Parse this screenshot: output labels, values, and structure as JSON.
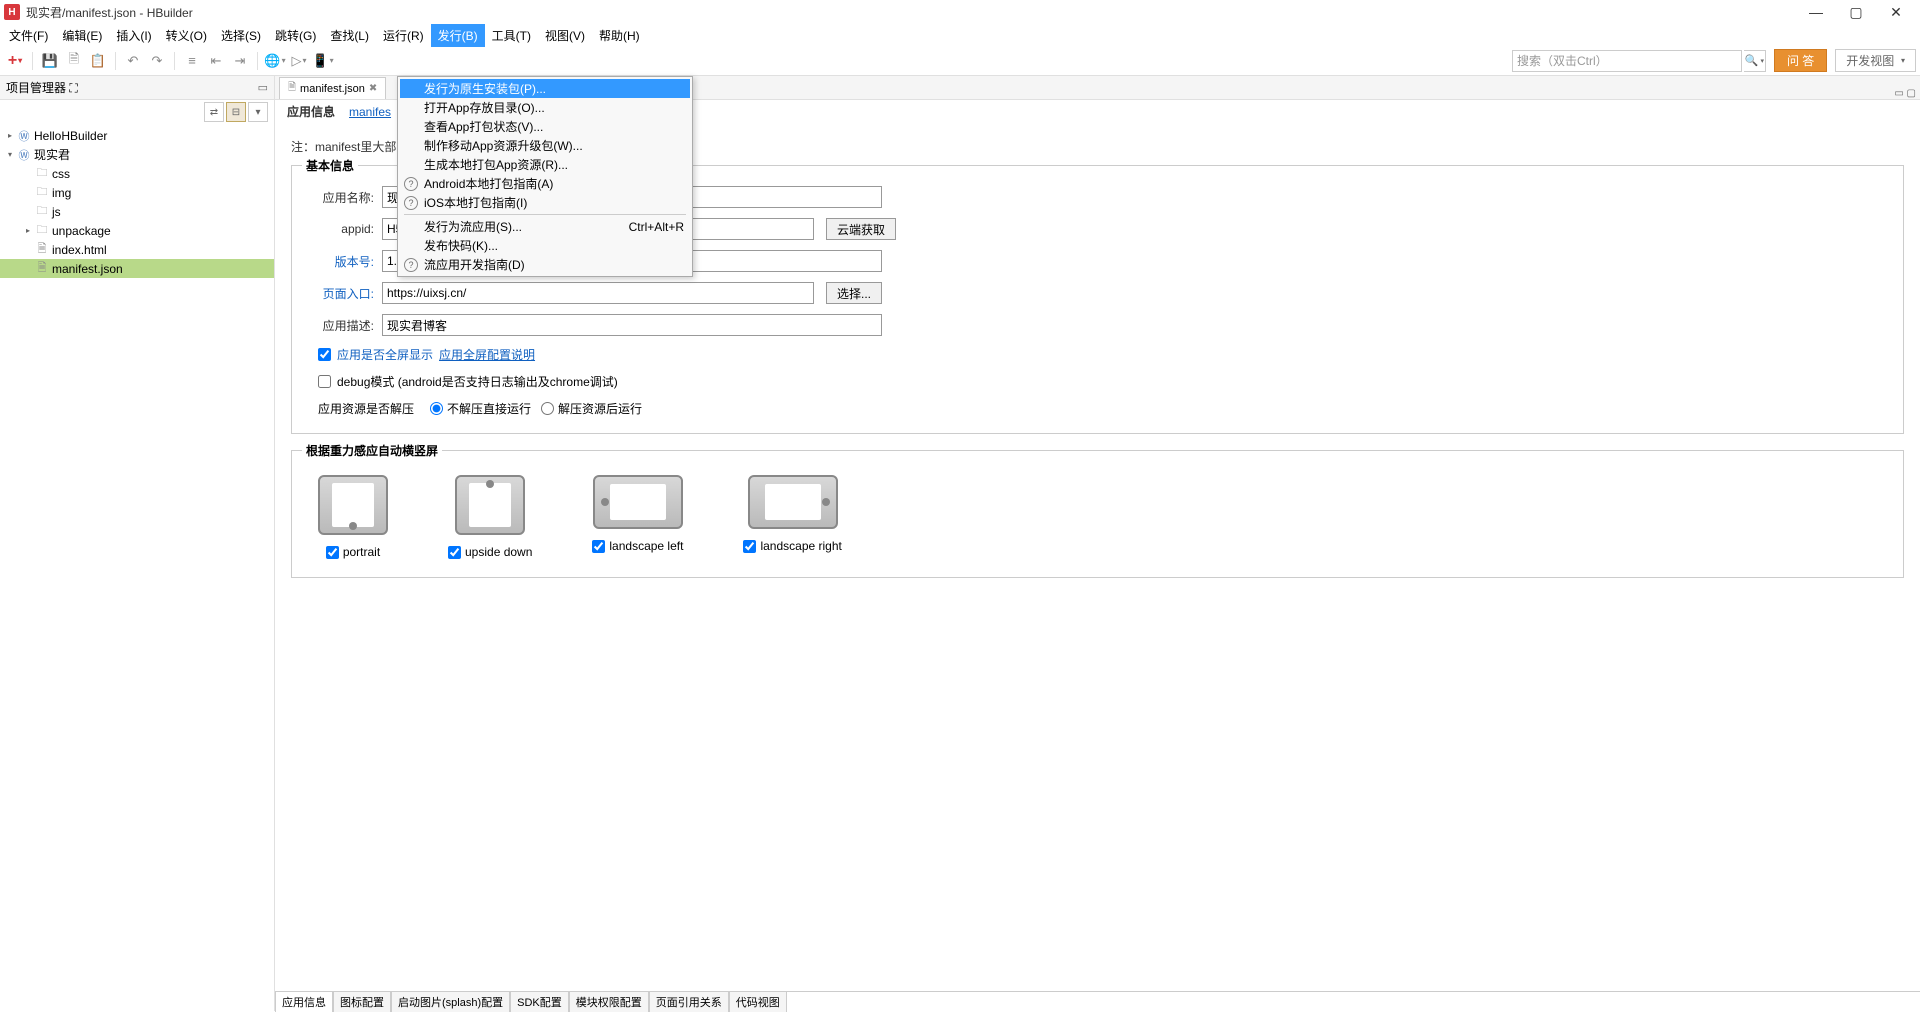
{
  "title": "现实君/manifest.json  -  HBuilder",
  "logo": "H",
  "menu": [
    "文件(F)",
    "编辑(E)",
    "插入(I)",
    "转义(O)",
    "选择(S)",
    "跳转(G)",
    "查找(L)",
    "运行(R)",
    "发行(B)",
    "工具(T)",
    "视图(V)",
    "帮助(H)"
  ],
  "toolbar": {
    "search_placeholder": "搜索（双击Ctrl）",
    "qa": "问 答",
    "view": "开发视图"
  },
  "sidebar": {
    "title": "项目管理器 ⛶",
    "tree": [
      {
        "expand": "▸",
        "icon": "web",
        "label": "HelloHBuilder",
        "indent": 0
      },
      {
        "expand": "▾",
        "icon": "web",
        "label": "现实君",
        "indent": 0
      },
      {
        "expand": "",
        "icon": "folder",
        "label": "css",
        "indent": 1
      },
      {
        "expand": "",
        "icon": "folder",
        "label": "img",
        "indent": 1
      },
      {
        "expand": "",
        "icon": "folder",
        "label": "js",
        "indent": 1
      },
      {
        "expand": "▸",
        "icon": "folder",
        "label": "unpackage",
        "indent": 1
      },
      {
        "expand": "",
        "icon": "file",
        "label": "index.html",
        "indent": 1
      },
      {
        "expand": "",
        "icon": "file",
        "label": "manifest.json",
        "indent": 1,
        "selected": true
      }
    ]
  },
  "dropdown": {
    "items": [
      {
        "label": "发行为原生安装包(P)...",
        "selected": true
      },
      {
        "label": "打开App存放目录(O)..."
      },
      {
        "label": "查看App打包状态(V)..."
      },
      {
        "label": "制作移动App资源升级包(W)..."
      },
      {
        "label": "生成本地打包App资源(R)..."
      },
      {
        "label": "Android本地打包指南(A)",
        "help": true
      },
      {
        "label": "iOS本地打包指南(I)",
        "help": true
      },
      {
        "sep": true
      },
      {
        "label": "发行为流应用(S)...",
        "shortcut": "Ctrl+Alt+R"
      },
      {
        "label": "发布快码(K)..."
      },
      {
        "label": "流应用开发指南(D)",
        "help": true
      }
    ]
  },
  "editor": {
    "tab": "manifest.json",
    "sub_tabs": {
      "active": "应用信息",
      "link": "manifes"
    },
    "note": "注：manifest里大部分                                                                                              示,其他部分需要通过App打包才可看到效果",
    "section1": {
      "title": "基本信息",
      "appname_label": "应用名称:",
      "appname": "现",
      "appid_label": "appid:",
      "appid": "H5",
      "appid_btn": "云端获取",
      "version_label": "版本号:",
      "version": "1.0",
      "entry_label": "页面入口:",
      "entry": "https://uixsj.cn/",
      "entry_btn": "选择...",
      "desc_label": "应用描述:",
      "desc": "现实君博客",
      "cb1": "应用是否全屏显示",
      "cb1_link": "应用全屏配置说明",
      "cb2": "debug模式 (android是否支持日志输出及chrome调试)",
      "radio_label": "应用资源是否解压",
      "radio1": "不解压直接运行",
      "radio2": "解压资源后运行"
    },
    "section2": {
      "title": "根据重力感应自动横竖屏",
      "o1": "portrait",
      "o2": "upside down",
      "o3": "landscape left",
      "o4": "landscape right"
    },
    "bottom_tabs": [
      "应用信息",
      "图标配置",
      "启动图片(splash)配置",
      "SDK配置",
      "模块权限配置",
      "页面引用关系",
      "代码视图"
    ]
  }
}
